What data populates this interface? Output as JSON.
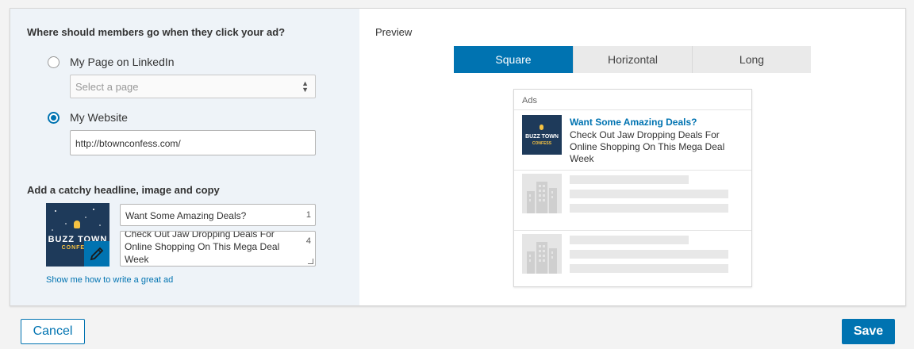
{
  "destination": {
    "title": "Where should members go when they click your ad?",
    "option_page_label": "My Page on LinkedIn",
    "option_page_checked": false,
    "page_select_placeholder": "Select a page",
    "option_website_label": "My Website",
    "option_website_checked": true,
    "website_url": "http://btownconfess.com/"
  },
  "creative": {
    "title": "Add a catchy headline, image and copy",
    "image_text_line1": "BUZZ TOWN",
    "image_text_line2": "CONFESS",
    "headline_value": "Want Some Amazing Deals?",
    "headline_counter": "1",
    "copy_value": "Check Out Jaw Dropping Deals For Online Shopping On This Mega Deal Week",
    "copy_counter": "4",
    "help_link": "Show me how to write a great ad"
  },
  "preview": {
    "title": "Preview",
    "tabs": [
      {
        "label": "Square",
        "active": true
      },
      {
        "label": "Horizontal",
        "active": false
      },
      {
        "label": "Long",
        "active": false
      }
    ],
    "ad_label": "Ads",
    "ad_headline": "Want Some Amazing Deals?",
    "ad_body": "Check Out Jaw Dropping Deals For Online Shopping On This Mega Deal Week",
    "ad_image_text_line1": "BUZZ TOWN",
    "ad_image_text_line2": "CONFESS"
  },
  "footer": {
    "cancel_label": "Cancel",
    "save_label": "Save"
  },
  "colors": {
    "accent": "#0073b1",
    "left_panel_bg": "#eef3f8",
    "thumb_bg": "#1e3a5a"
  }
}
